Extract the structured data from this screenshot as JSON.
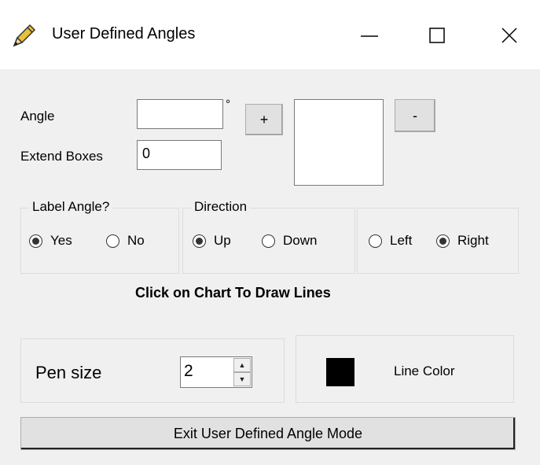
{
  "window": {
    "title": "User Defined Angles",
    "icon": "pencil-icon"
  },
  "controls": {
    "minimize": "—",
    "maximize": "☐",
    "close": "✕"
  },
  "angle": {
    "label": "Angle",
    "value": "",
    "degree": "°"
  },
  "buttons": {
    "add": "+",
    "remove": "-",
    "exit": "Exit User Defined Angle Mode"
  },
  "extend": {
    "label": "Extend Boxes",
    "value": "0"
  },
  "label_angle": {
    "title": "Label Angle?",
    "yes": "Yes",
    "no": "No",
    "selected": "Yes"
  },
  "direction": {
    "title": "Direction",
    "up": "Up",
    "down": "Down",
    "selected": "Up"
  },
  "horizontal": {
    "left": "Left",
    "right": "Right",
    "selected": "Right"
  },
  "hint": "Click on Chart To Draw Lines",
  "pen": {
    "label": "Pen size",
    "value": "2"
  },
  "line_color": {
    "label": "Line Color",
    "color": "#000000"
  }
}
